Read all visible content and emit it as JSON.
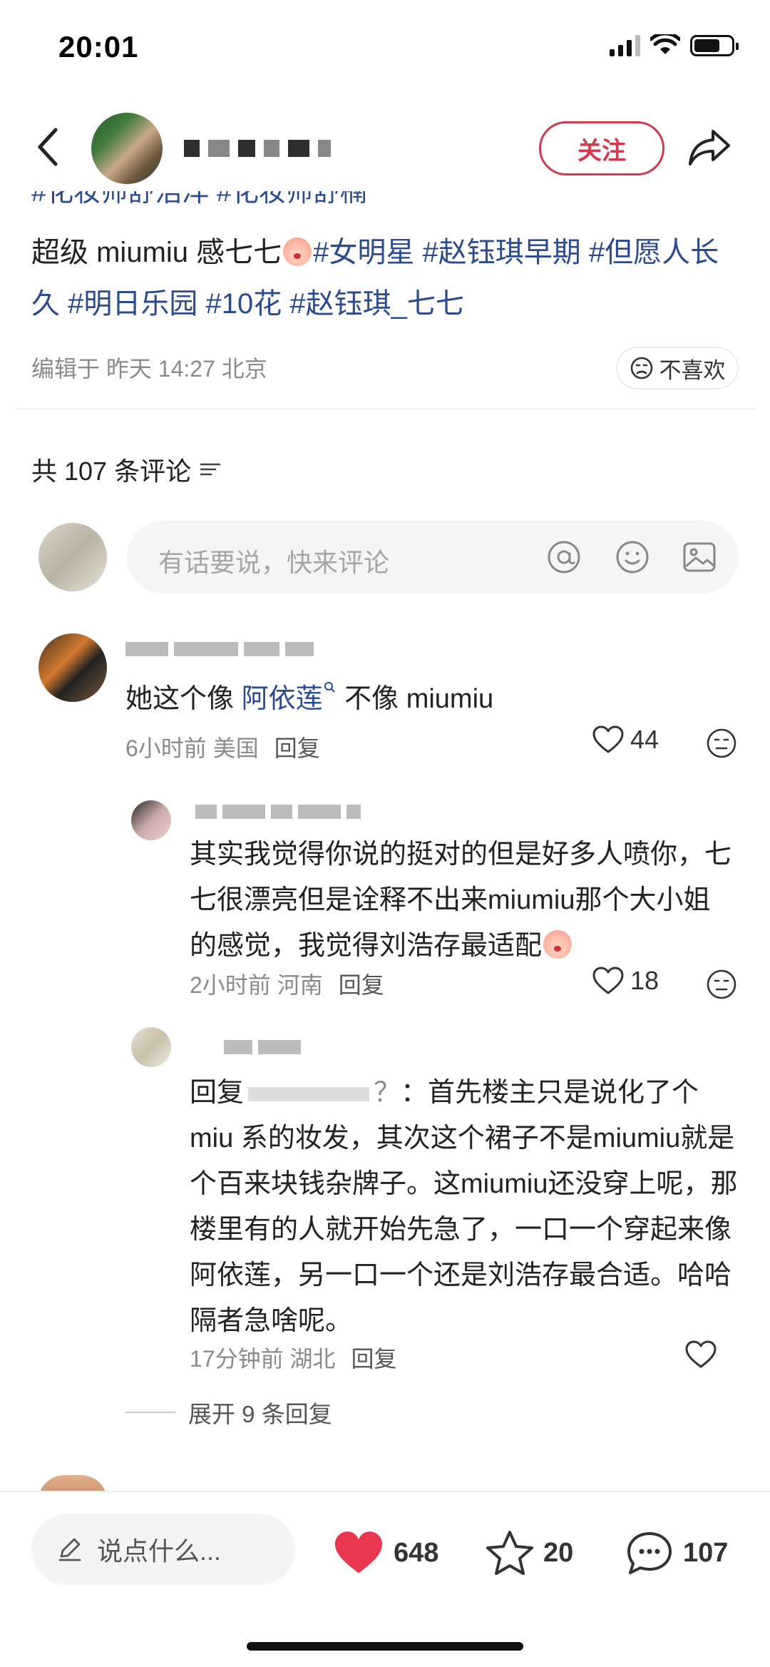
{
  "status_bar": {
    "time": "20:01"
  },
  "header": {
    "follow_label": "关注"
  },
  "post": {
    "tags_cut": "#化妆师舒浩洋 #化妆师舒楠",
    "body_prefix": "超级 miumiu 感七七",
    "tags": [
      "#女明星",
      "#赵钰琪早期",
      "#但愿人长久",
      "#明日乐园",
      "#10花",
      "#赵钰琪_七七"
    ],
    "meta": "编辑于 昨天 14:27 北京",
    "dislike_label": "不喜欢"
  },
  "comments_header": {
    "label": "共 107 条评论"
  },
  "composer": {
    "placeholder": "有话要说，快来评论"
  },
  "comments": [
    {
      "text_pre": "她这个像 ",
      "text_link": "阿依莲",
      "text_post": " 不像 miumiu",
      "time": "6小时前",
      "location": "美国",
      "reply": "回复",
      "likes": "44"
    },
    {
      "text": "其实我觉得你说的挺对的但是好多人喷你，七七很漂亮但是诠释不出来miumiu那个大小姐的感觉，我觉得刘浩存最适配",
      "time": "2小时前",
      "location": "河南",
      "reply": "回复",
      "likes": "18"
    },
    {
      "reply_prefix": "回复",
      "reply_target": "？",
      "text": "：首先楼主只是说化了个 miu 系的妆发，其次这个裙子不是miumiu就是个百来块钱杂牌子。这miumiu还没穿上呢，那楼里有的人就开始先急了，一口一个穿起来像阿依莲，另一口一个还是刘浩存最合适。哈哈隔者急啥呢。",
      "time": "17分钟前",
      "location": "湖北",
      "reply": "回复"
    }
  ],
  "expand": {
    "label": "展开 9 条回复"
  },
  "bottom_bar": {
    "say_placeholder": "说点什么...",
    "likes": "648",
    "stars": "20",
    "comments": "107"
  },
  "colors": {
    "accent": "#d2394f",
    "tag": "#2a4b8d",
    "meta": "#8a8a8a",
    "heart": "#e8374f"
  }
}
